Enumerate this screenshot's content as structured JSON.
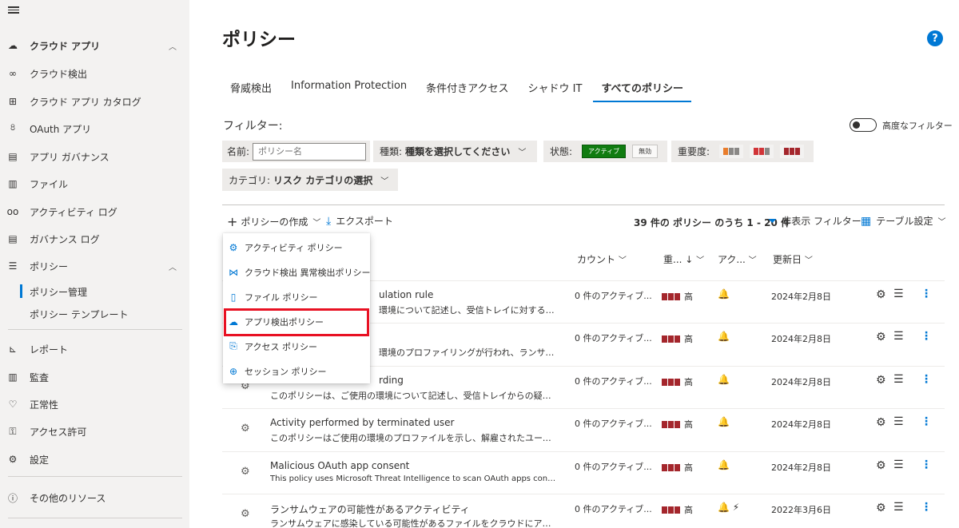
{
  "sidebar": {
    "items": [
      {
        "label": "クラウド アプリ",
        "icon": "cloud-icon",
        "chevron": "︿"
      },
      {
        "label": "クラウド検出",
        "icon": "binoculars-icon"
      },
      {
        "label": "クラウド アプリ カタログ",
        "icon": "catalog-icon"
      },
      {
        "label": "OAuth アプリ",
        "icon": "oauth-icon"
      },
      {
        "label": "アプリ ガバナンス",
        "icon": "governance-icon"
      },
      {
        "label": "ファイル",
        "icon": "file-icon"
      },
      {
        "label": "アクティビティ ログ",
        "icon": "glasses-icon"
      },
      {
        "label": "ガバナンス ログ",
        "icon": "clipboard-icon"
      },
      {
        "label": "ポリシー",
        "icon": "policy-icon",
        "chevron": "︿"
      },
      {
        "label": "レポート",
        "icon": "chart-icon"
      },
      {
        "label": "監査",
        "icon": "audit-icon"
      },
      {
        "label": "正常性",
        "icon": "heart-icon"
      },
      {
        "label": "アクセス許可",
        "icon": "key-icon"
      },
      {
        "label": "設定",
        "icon": "gear-icon"
      },
      {
        "label": "その他のリソース",
        "icon": "info-icon"
      }
    ],
    "sub_items": [
      {
        "label": "ポリシー管理"
      },
      {
        "label": "ポリシー テンプレート"
      }
    ]
  },
  "page": {
    "title": "ポリシー",
    "help": "?"
  },
  "tabs": [
    {
      "label": "脅威検出"
    },
    {
      "label": "Information Protection"
    },
    {
      "label": "条件付きアクセス"
    },
    {
      "label": "シャドウ IT"
    },
    {
      "label": "すべてのポリシー"
    }
  ],
  "filters": {
    "title": "フィルター:",
    "advanced_label": "高度なフィルター",
    "name_label": "名前:",
    "name_placeholder": "ポリシー名",
    "type_label": "種類:",
    "type_value": "種類を選択してください",
    "status_label": "状態:",
    "status_active": "アクティブ",
    "status_disabled": "無効",
    "severity_label": "重要度:",
    "category_label": "カテゴリ:",
    "category_value": "リスク カテゴリの選択",
    "colors": {
      "low": "#e97d2c",
      "medium": "#d13438",
      "high": "#a4262c",
      "gray": "#8a8886"
    }
  },
  "toolbar": {
    "create_label": "ポリシーの作成",
    "export_label": "エクスポート",
    "count_bold": "39 件の ポリシー のうち 1 - 20 件",
    "hide_filter_label": "非表示 フィルター",
    "table_settings_label": "テーブル設定"
  },
  "table": {
    "headers": {
      "count": "カウント",
      "severity": "重...",
      "action": "アク...",
      "modified": "更新日"
    },
    "rows": [
      {
        "name": "ulation rule",
        "desc": "環境について記述し、受信トレイに対する疑わし...",
        "count": "0 件のアクティブ...",
        "sev": "高",
        "actions": "🔔",
        "date": "2024年2月8日",
        "icon": "policy-row-icon"
      },
      {
        "name": "",
        "desc": "環境のプロファイリングが行われ、ランサムウェ...",
        "count": "0 件のアクティブ...",
        "sev": "高",
        "actions": "🔔",
        "date": "2024年2月8日",
        "icon": "policy-row-icon"
      },
      {
        "name": "rding",
        "desc": "このポリシーは、ご使用の環境について記述し、受信トレイからの疑わしい...",
        "count": "0 件のアクティブ...",
        "sev": "高",
        "actions": "🔔",
        "date": "2024年2月8日",
        "icon": "policy-row-icon"
      },
      {
        "name": "Activity performed by terminated user",
        "desc": "このポリシーはご使用の環境のプロファイルを示し、解雇されたユーザーが...",
        "count": "0 件のアクティブ...",
        "sev": "高",
        "actions": "🔔",
        "date": "2024年2月8日",
        "icon": "policy-row-icon"
      },
      {
        "name": "Malicious OAuth app consent",
        "desc": "This policy uses Microsoft Threat Intelligence to scan OAuth apps connected t...",
        "count": "0 件のアクティブ...",
        "sev": "高",
        "actions": "🔔",
        "date": "2024年2月8日",
        "icon": "policy-row-icon"
      },
      {
        "name": "ランサムウェアの可能性があるアクティビティ",
        "desc": "ランサムウェアに感染している可能性があるファイルをクラウドにアップロ...",
        "count": "0 件のアクティブ...",
        "sev": "高",
        "actions": "🔔 ⚡",
        "date": "2022年3月6日",
        "icon": "policy-row-icon"
      }
    ]
  },
  "menu": {
    "items": [
      {
        "label": "アクティビティ ポリシー",
        "icon": "activity-policy-icon",
        "glyph": "⚙"
      },
      {
        "label": "クラウド検出 異常検出ポリシー",
        "icon": "anomaly-policy-icon",
        "glyph": "⋈"
      },
      {
        "label": "ファイル ポリシー",
        "icon": "file-policy-icon",
        "glyph": "▯"
      },
      {
        "label": "アプリ検出ポリシー",
        "icon": "app-discovery-icon",
        "glyph": "☁"
      },
      {
        "label": "アクセス ポリシー",
        "icon": "access-policy-icon",
        "glyph": "⎘"
      },
      {
        "label": "セッション ポリシー",
        "icon": "session-policy-icon",
        "glyph": "⊕"
      }
    ],
    "highlight_color": "#e81123"
  }
}
